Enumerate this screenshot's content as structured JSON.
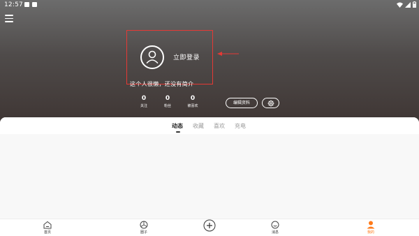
{
  "status_bar": {
    "time": "12:57"
  },
  "profile": {
    "login_text": "立即登录",
    "bio": "这个人很懒，还没有简介",
    "stats": [
      {
        "value": "0",
        "label": "关注"
      },
      {
        "value": "0",
        "label": "粉丝"
      },
      {
        "value": "0",
        "label": "被喜欢"
      }
    ],
    "edit_label": "编辑资料"
  },
  "tabs": [
    {
      "label": "动态",
      "active": true
    },
    {
      "label": "收藏",
      "active": false
    },
    {
      "label": "喜欢",
      "active": false
    },
    {
      "label": "充电",
      "active": false
    }
  ],
  "bottom_nav": [
    {
      "label": "首页",
      "icon": "home-icon"
    },
    {
      "label": "圈子",
      "icon": "circle-icon"
    },
    {
      "label": "",
      "icon": "plus-icon"
    },
    {
      "label": "消息",
      "icon": "message-icon"
    },
    {
      "label": "我的",
      "icon": "profile-icon",
      "active": true
    }
  ],
  "colors": {
    "accent": "#ff7a1a",
    "highlight_box": "#e53935",
    "header_top": "#6c6c6c",
    "header_bottom": "#3f3634"
  }
}
